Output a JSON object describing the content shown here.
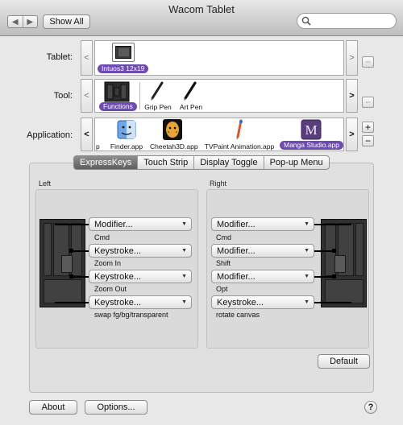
{
  "window": {
    "title": "Wacom Tablet"
  },
  "toolbar": {
    "back_label": "◀",
    "forward_label": "▶",
    "show_all_label": "Show All",
    "search": {
      "value": "",
      "placeholder": ""
    }
  },
  "tablet_row": {
    "label": "Tablet:",
    "left_arrow": "<",
    "right_arrow": ">",
    "remove_label": "−",
    "items": [
      {
        "label": "Intuos3 12x19",
        "selected": true,
        "icon": "tablet-icon"
      }
    ]
  },
  "tool_row": {
    "label": "Tool:",
    "left_arrow": "<",
    "right_arrow": ">",
    "remove_label": "−",
    "items": [
      {
        "label": "Functions",
        "selected": true,
        "icon": "functions-icon"
      },
      {
        "label": "Grip Pen",
        "selected": false,
        "icon": "grip-pen-icon"
      },
      {
        "label": "Art Pen",
        "selected": false,
        "icon": "art-pen-icon"
      }
    ]
  },
  "application_row": {
    "label": "Application:",
    "left_arrow": "<",
    "right_arrow": ">",
    "add_label": "+",
    "remove_label": "−",
    "clipped_item": "p",
    "items": [
      {
        "label": "Finder.app",
        "selected": false,
        "icon": "finder-icon"
      },
      {
        "label": "Cheetah3D.app",
        "selected": false,
        "icon": "cheetah3d-icon"
      },
      {
        "label": "TVPaint Animation.app",
        "selected": false,
        "icon": "tvpaint-icon"
      },
      {
        "label": "Manga Studio.app",
        "selected": true,
        "icon": "manga-studio-icon"
      }
    ]
  },
  "tabs": [
    {
      "label": "ExpressKeys",
      "active": true
    },
    {
      "label": "Touch Strip",
      "active": false
    },
    {
      "label": "Display Toggle",
      "active": false
    },
    {
      "label": "Pop-up Menu",
      "active": false
    }
  ],
  "left_panel": {
    "label": "Left",
    "keys": [
      {
        "setting": "Modifier...",
        "value": "Cmd"
      },
      {
        "setting": "Keystroke...",
        "value": "Zoom In"
      },
      {
        "setting": "Keystroke...",
        "value": "Zoom Out"
      },
      {
        "setting": "Keystroke...",
        "value": "swap fg/bg/transparent"
      }
    ]
  },
  "right_panel": {
    "label": "Right",
    "keys": [
      {
        "setting": "Modifier...",
        "value": "Cmd"
      },
      {
        "setting": "Modifier...",
        "value": "Shift"
      },
      {
        "setting": "Modifier...",
        "value": "Opt"
      },
      {
        "setting": "Keystroke...",
        "value": "rotate canvas"
      }
    ]
  },
  "popup_caret": "▼",
  "buttons": {
    "default_label": "Default",
    "about_label": "About",
    "options_label": "Options...",
    "help_label": "?"
  },
  "colors": {
    "selection_purple": "#6e4ab5",
    "window_bg": "#e8e8e8"
  }
}
